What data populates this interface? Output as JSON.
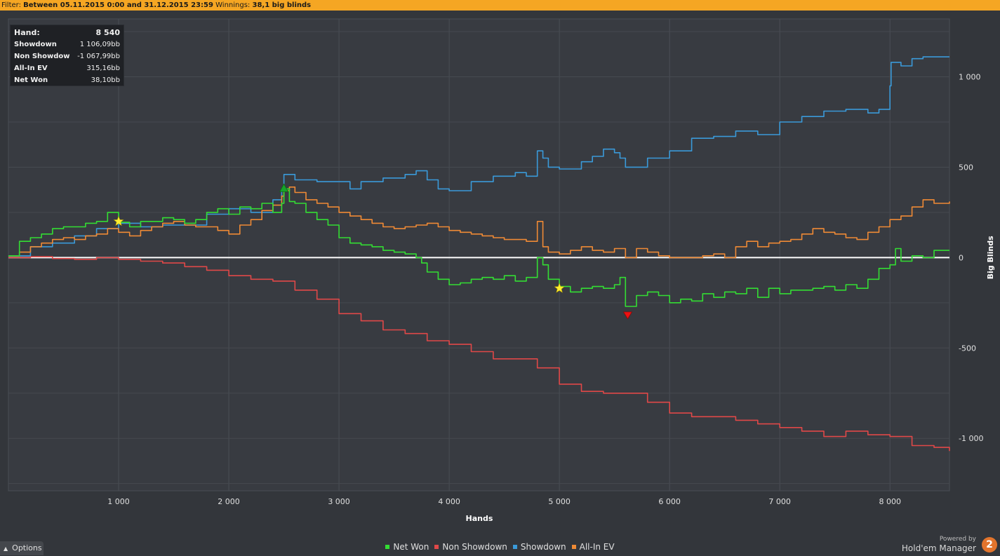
{
  "filter": {
    "label": "Filter:",
    "range": "Between 05.11.2015 0:00 and 31.12.2015 23:59",
    "winnings_label": "Winnings:",
    "winnings_value": "38,1 big blinds"
  },
  "stats": [
    {
      "label": "Hand:",
      "value": "8 540"
    },
    {
      "label": "Showdown",
      "value": "1 106,09bb"
    },
    {
      "label": "Non Showdown",
      "value": "-1 067,99bb"
    },
    {
      "label": "All-In EV",
      "value": "315,16bb"
    },
    {
      "label": "Net Won",
      "value": "38,10bb"
    }
  ],
  "options": {
    "label": "Options"
  },
  "brand": {
    "powered": "Powered by",
    "product": "Hold'em Manager",
    "logo": "2"
  },
  "colors": {
    "net_won": "#33dd33",
    "non_showdown": "#e04848",
    "showdown": "#3a9ad9",
    "allin_ev": "#ef8a35",
    "zero_line": "#ffffff",
    "background": "#33363b",
    "filter_bar": "#f5a623"
  },
  "chart_data": {
    "type": "line",
    "xlabel": "Hands",
    "ylabel": "Big Blinds",
    "xlim": [
      0,
      8540
    ],
    "ylim": [
      -1290,
      1320
    ],
    "xticks": [
      1000,
      2000,
      3000,
      4000,
      5000,
      6000,
      7000,
      8000
    ],
    "xtick_labels": [
      "1 000",
      "2 000",
      "3 000",
      "4 000",
      "5 000",
      "6 000",
      "7 000",
      "8 000"
    ],
    "yticks": [
      1000,
      500,
      0,
      -500,
      -1000
    ],
    "ytick_labels": [
      "1 000",
      "500",
      "0",
      "-500",
      "-1 000"
    ],
    "grid": true,
    "legend_position": "bottom-center",
    "series": [
      {
        "name": "Net Won",
        "x": [
          0,
          100,
          200,
          300,
          400,
          500,
          600,
          700,
          800,
          900,
          1000,
          1100,
          1200,
          1300,
          1400,
          1500,
          1600,
          1700,
          1800,
          1900,
          2000,
          2100,
          2200,
          2300,
          2400,
          2480,
          2500,
          2550,
          2600,
          2700,
          2800,
          2900,
          3000,
          3100,
          3200,
          3300,
          3400,
          3500,
          3600,
          3700,
          3750,
          3800,
          3900,
          4000,
          4100,
          4200,
          4300,
          4400,
          4500,
          4600,
          4700,
          4800,
          4850,
          4900,
          5000,
          5100,
          5200,
          5300,
          5400,
          5500,
          5550,
          5600,
          5700,
          5800,
          5900,
          6000,
          6100,
          6200,
          6300,
          6400,
          6500,
          6600,
          6700,
          6800,
          6900,
          7000,
          7100,
          7200,
          7300,
          7400,
          7500,
          7600,
          7700,
          7800,
          7900,
          8000,
          8050,
          8100,
          8200,
          8300,
          8400,
          8540
        ],
        "y": [
          10,
          90,
          110,
          130,
          160,
          170,
          170,
          190,
          200,
          250,
          195,
          170,
          200,
          200,
          220,
          210,
          190,
          210,
          250,
          270,
          240,
          280,
          270,
          300,
          250,
          300,
          380,
          310,
          300,
          250,
          210,
          180,
          110,
          80,
          70,
          60,
          40,
          30,
          20,
          0,
          -30,
          -80,
          -120,
          -150,
          -140,
          -120,
          -110,
          -120,
          -100,
          -130,
          -110,
          0,
          -40,
          -120,
          -160,
          -190,
          -170,
          -160,
          -170,
          -150,
          -110,
          -270,
          -210,
          -190,
          -210,
          -250,
          -230,
          -240,
          -200,
          -220,
          -190,
          -200,
          -170,
          -220,
          -170,
          -200,
          -180,
          -180,
          -170,
          -160,
          -180,
          -150,
          -170,
          -120,
          -60,
          -40,
          50,
          -20,
          10,
          0,
          40,
          40
        ]
      },
      {
        "name": "Non Showdown",
        "x": [
          0,
          200,
          400,
          600,
          800,
          1000,
          1200,
          1400,
          1600,
          1800,
          2000,
          2200,
          2400,
          2600,
          2800,
          3000,
          3200,
          3400,
          3600,
          3800,
          4000,
          4200,
          4400,
          4600,
          4800,
          5000,
          5200,
          5400,
          5600,
          5800,
          6000,
          6200,
          6400,
          6600,
          6800,
          7000,
          7200,
          7400,
          7600,
          7800,
          8000,
          8200,
          8400,
          8540
        ],
        "y": [
          0,
          5,
          -5,
          -10,
          0,
          -10,
          -20,
          -30,
          -50,
          -70,
          -100,
          -120,
          -130,
          -180,
          -230,
          -310,
          -350,
          -400,
          -420,
          -460,
          -480,
          -520,
          -560,
          -560,
          -610,
          -700,
          -740,
          -750,
          -750,
          -800,
          -860,
          -880,
          -880,
          -900,
          -920,
          -940,
          -960,
          -990,
          -960,
          -980,
          -990,
          -1040,
          -1050,
          -1070
        ]
      },
      {
        "name": "Showdown",
        "x": [
          0,
          200,
          400,
          600,
          800,
          1000,
          1200,
          1400,
          1600,
          1800,
          2000,
          2200,
          2400,
          2480,
          2500,
          2600,
          2800,
          3000,
          3100,
          3200,
          3400,
          3600,
          3700,
          3800,
          3900,
          4000,
          4200,
          4400,
          4600,
          4700,
          4800,
          4850,
          4900,
          5000,
          5200,
          5300,
          5400,
          5500,
          5550,
          5600,
          5800,
          6000,
          6200,
          6400,
          6600,
          6800,
          7000,
          7200,
          7400,
          7600,
          7800,
          7900,
          8000,
          8010,
          8100,
          8200,
          8300,
          8400,
          8540
        ],
        "y": [
          10,
          60,
          80,
          120,
          160,
          190,
          170,
          180,
          180,
          240,
          270,
          250,
          320,
          380,
          460,
          430,
          420,
          420,
          380,
          420,
          440,
          460,
          480,
          430,
          380,
          370,
          420,
          450,
          470,
          450,
          590,
          550,
          500,
          490,
          530,
          560,
          600,
          580,
          550,
          500,
          550,
          590,
          660,
          670,
          700,
          680,
          750,
          780,
          810,
          820,
          800,
          820,
          950,
          1080,
          1060,
          1100,
          1110,
          1110,
          1110
        ]
      },
      {
        "name": "All-In EV",
        "x": [
          0,
          100,
          200,
          300,
          400,
          500,
          600,
          700,
          800,
          900,
          1000,
          1100,
          1200,
          1300,
          1400,
          1500,
          1600,
          1700,
          1800,
          1900,
          2000,
          2100,
          2200,
          2300,
          2400,
          2480,
          2500,
          2550,
          2600,
          2700,
          2800,
          2900,
          3000,
          3100,
          3200,
          3300,
          3400,
          3500,
          3600,
          3700,
          3800,
          3900,
          4000,
          4100,
          4200,
          4300,
          4400,
          4500,
          4600,
          4700,
          4800,
          4850,
          4900,
          5000,
          5100,
          5200,
          5300,
          5400,
          5500,
          5600,
          5700,
          5800,
          5900,
          6000,
          6100,
          6200,
          6300,
          6400,
          6500,
          6600,
          6700,
          6800,
          6900,
          7000,
          7100,
          7200,
          7300,
          7400,
          7500,
          7600,
          7700,
          7800,
          7900,
          8000,
          8100,
          8200,
          8300,
          8400,
          8540
        ],
        "y": [
          10,
          30,
          60,
          80,
          100,
          110,
          100,
          120,
          130,
          160,
          140,
          120,
          150,
          170,
          190,
          200,
          180,
          170,
          170,
          150,
          130,
          180,
          210,
          260,
          290,
          340,
          370,
          390,
          360,
          320,
          300,
          280,
          250,
          230,
          210,
          190,
          170,
          160,
          170,
          180,
          190,
          170,
          150,
          140,
          130,
          120,
          110,
          100,
          100,
          90,
          200,
          60,
          30,
          20,
          40,
          60,
          40,
          30,
          50,
          0,
          50,
          30,
          10,
          0,
          0,
          0,
          10,
          20,
          0,
          60,
          90,
          60,
          80,
          90,
          100,
          130,
          160,
          140,
          130,
          110,
          100,
          140,
          170,
          210,
          230,
          280,
          320,
          300,
          310
        ]
      }
    ],
    "markers": [
      {
        "shape": "star",
        "series": "Net Won",
        "x": 1000,
        "y": 200
      },
      {
        "shape": "triangle-up",
        "series": "Net Won",
        "x": 2500,
        "y": 380
      },
      {
        "shape": "star",
        "series": "Net Won",
        "x": 5000,
        "y": -170
      },
      {
        "shape": "triangle-down",
        "series": "Net Won",
        "x": 5620,
        "y": -320
      }
    ]
  }
}
